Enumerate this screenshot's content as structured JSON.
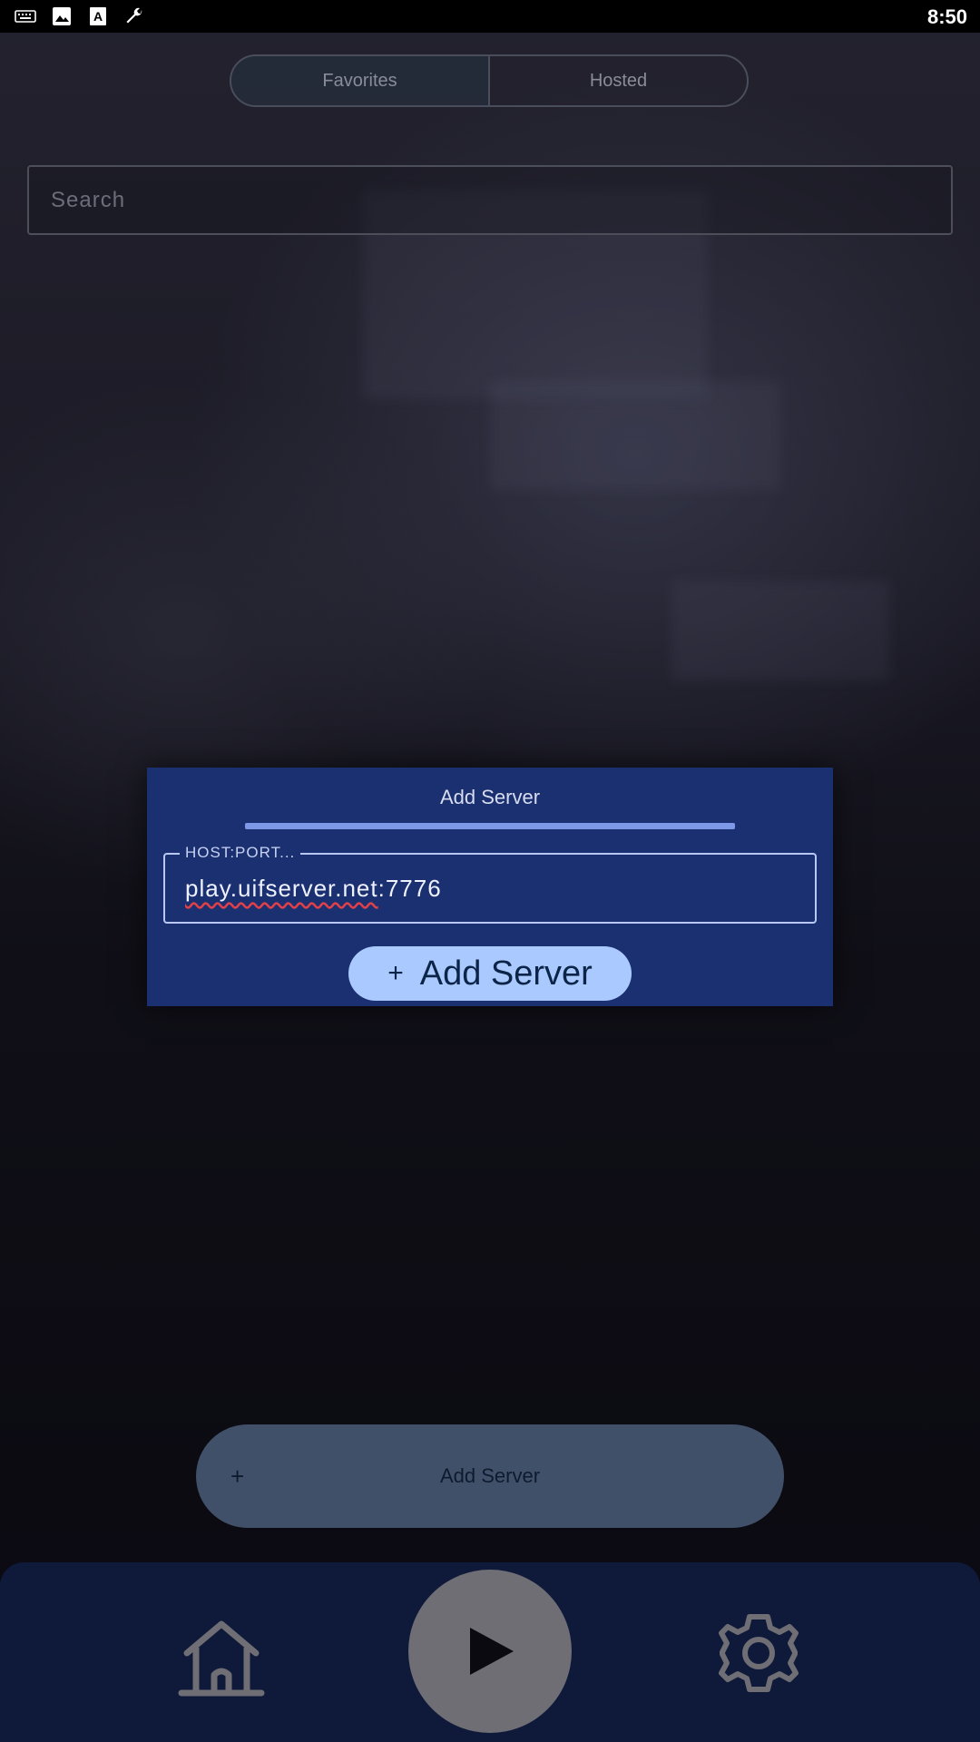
{
  "status_bar": {
    "time": "8:50",
    "icons": [
      "keyboard-icon",
      "image-icon",
      "a-box-icon",
      "wrench-icon"
    ]
  },
  "tabs": [
    {
      "label": "Favorites",
      "active": true
    },
    {
      "label": "Hosted",
      "active": false
    }
  ],
  "search": {
    "placeholder": "Search",
    "value": ""
  },
  "dialog": {
    "title": "Add Server",
    "field_label": "HOST:PORT...",
    "field_value_host": "play.uifserver.net",
    "field_value_port": ":7776",
    "button_label": "Add Server",
    "accent": "#1b3070",
    "button_color": "#a9c9ff"
  },
  "add_server_button": {
    "label": "Add Server"
  },
  "bottom_nav": {
    "items": [
      "home-icon",
      "play-icon",
      "gear-icon"
    ]
  }
}
